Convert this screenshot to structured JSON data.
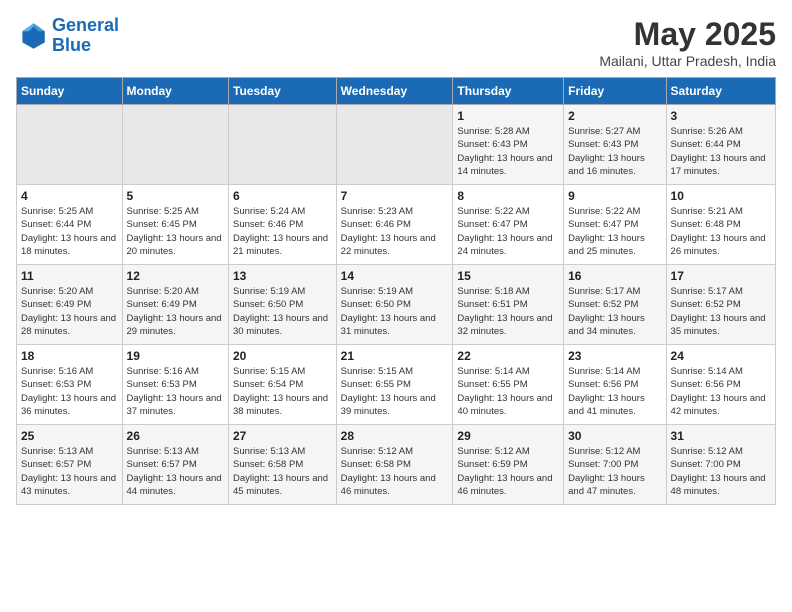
{
  "logo": {
    "line1": "General",
    "line2": "Blue"
  },
  "title": {
    "month_year": "May 2025",
    "location": "Mailani, Uttar Pradesh, India"
  },
  "headers": [
    "Sunday",
    "Monday",
    "Tuesday",
    "Wednesday",
    "Thursday",
    "Friday",
    "Saturday"
  ],
  "weeks": [
    [
      {
        "day": "",
        "sunrise": "",
        "sunset": "",
        "daylight": ""
      },
      {
        "day": "",
        "sunrise": "",
        "sunset": "",
        "daylight": ""
      },
      {
        "day": "",
        "sunrise": "",
        "sunset": "",
        "daylight": ""
      },
      {
        "day": "",
        "sunrise": "",
        "sunset": "",
        "daylight": ""
      },
      {
        "day": "1",
        "sunrise": "Sunrise: 5:28 AM",
        "sunset": "Sunset: 6:43 PM",
        "daylight": "Daylight: 13 hours and 14 minutes."
      },
      {
        "day": "2",
        "sunrise": "Sunrise: 5:27 AM",
        "sunset": "Sunset: 6:43 PM",
        "daylight": "Daylight: 13 hours and 16 minutes."
      },
      {
        "day": "3",
        "sunrise": "Sunrise: 5:26 AM",
        "sunset": "Sunset: 6:44 PM",
        "daylight": "Daylight: 13 hours and 17 minutes."
      }
    ],
    [
      {
        "day": "4",
        "sunrise": "Sunrise: 5:25 AM",
        "sunset": "Sunset: 6:44 PM",
        "daylight": "Daylight: 13 hours and 18 minutes."
      },
      {
        "day": "5",
        "sunrise": "Sunrise: 5:25 AM",
        "sunset": "Sunset: 6:45 PM",
        "daylight": "Daylight: 13 hours and 20 minutes."
      },
      {
        "day": "6",
        "sunrise": "Sunrise: 5:24 AM",
        "sunset": "Sunset: 6:46 PM",
        "daylight": "Daylight: 13 hours and 21 minutes."
      },
      {
        "day": "7",
        "sunrise": "Sunrise: 5:23 AM",
        "sunset": "Sunset: 6:46 PM",
        "daylight": "Daylight: 13 hours and 22 minutes."
      },
      {
        "day": "8",
        "sunrise": "Sunrise: 5:22 AM",
        "sunset": "Sunset: 6:47 PM",
        "daylight": "Daylight: 13 hours and 24 minutes."
      },
      {
        "day": "9",
        "sunrise": "Sunrise: 5:22 AM",
        "sunset": "Sunset: 6:47 PM",
        "daylight": "Daylight: 13 hours and 25 minutes."
      },
      {
        "day": "10",
        "sunrise": "Sunrise: 5:21 AM",
        "sunset": "Sunset: 6:48 PM",
        "daylight": "Daylight: 13 hours and 26 minutes."
      }
    ],
    [
      {
        "day": "11",
        "sunrise": "Sunrise: 5:20 AM",
        "sunset": "Sunset: 6:49 PM",
        "daylight": "Daylight: 13 hours and 28 minutes."
      },
      {
        "day": "12",
        "sunrise": "Sunrise: 5:20 AM",
        "sunset": "Sunset: 6:49 PM",
        "daylight": "Daylight: 13 hours and 29 minutes."
      },
      {
        "day": "13",
        "sunrise": "Sunrise: 5:19 AM",
        "sunset": "Sunset: 6:50 PM",
        "daylight": "Daylight: 13 hours and 30 minutes."
      },
      {
        "day": "14",
        "sunrise": "Sunrise: 5:19 AM",
        "sunset": "Sunset: 6:50 PM",
        "daylight": "Daylight: 13 hours and 31 minutes."
      },
      {
        "day": "15",
        "sunrise": "Sunrise: 5:18 AM",
        "sunset": "Sunset: 6:51 PM",
        "daylight": "Daylight: 13 hours and 32 minutes."
      },
      {
        "day": "16",
        "sunrise": "Sunrise: 5:17 AM",
        "sunset": "Sunset: 6:52 PM",
        "daylight": "Daylight: 13 hours and 34 minutes."
      },
      {
        "day": "17",
        "sunrise": "Sunrise: 5:17 AM",
        "sunset": "Sunset: 6:52 PM",
        "daylight": "Daylight: 13 hours and 35 minutes."
      }
    ],
    [
      {
        "day": "18",
        "sunrise": "Sunrise: 5:16 AM",
        "sunset": "Sunset: 6:53 PM",
        "daylight": "Daylight: 13 hours and 36 minutes."
      },
      {
        "day": "19",
        "sunrise": "Sunrise: 5:16 AM",
        "sunset": "Sunset: 6:53 PM",
        "daylight": "Daylight: 13 hours and 37 minutes."
      },
      {
        "day": "20",
        "sunrise": "Sunrise: 5:15 AM",
        "sunset": "Sunset: 6:54 PM",
        "daylight": "Daylight: 13 hours and 38 minutes."
      },
      {
        "day": "21",
        "sunrise": "Sunrise: 5:15 AM",
        "sunset": "Sunset: 6:55 PM",
        "daylight": "Daylight: 13 hours and 39 minutes."
      },
      {
        "day": "22",
        "sunrise": "Sunrise: 5:14 AM",
        "sunset": "Sunset: 6:55 PM",
        "daylight": "Daylight: 13 hours and 40 minutes."
      },
      {
        "day": "23",
        "sunrise": "Sunrise: 5:14 AM",
        "sunset": "Sunset: 6:56 PM",
        "daylight": "Daylight: 13 hours and 41 minutes."
      },
      {
        "day": "24",
        "sunrise": "Sunrise: 5:14 AM",
        "sunset": "Sunset: 6:56 PM",
        "daylight": "Daylight: 13 hours and 42 minutes."
      }
    ],
    [
      {
        "day": "25",
        "sunrise": "Sunrise: 5:13 AM",
        "sunset": "Sunset: 6:57 PM",
        "daylight": "Daylight: 13 hours and 43 minutes."
      },
      {
        "day": "26",
        "sunrise": "Sunrise: 5:13 AM",
        "sunset": "Sunset: 6:57 PM",
        "daylight": "Daylight: 13 hours and 44 minutes."
      },
      {
        "day": "27",
        "sunrise": "Sunrise: 5:13 AM",
        "sunset": "Sunset: 6:58 PM",
        "daylight": "Daylight: 13 hours and 45 minutes."
      },
      {
        "day": "28",
        "sunrise": "Sunrise: 5:12 AM",
        "sunset": "Sunset: 6:58 PM",
        "daylight": "Daylight: 13 hours and 46 minutes."
      },
      {
        "day": "29",
        "sunrise": "Sunrise: 5:12 AM",
        "sunset": "Sunset: 6:59 PM",
        "daylight": "Daylight: 13 hours and 46 minutes."
      },
      {
        "day": "30",
        "sunrise": "Sunrise: 5:12 AM",
        "sunset": "Sunset: 7:00 PM",
        "daylight": "Daylight: 13 hours and 47 minutes."
      },
      {
        "day": "31",
        "sunrise": "Sunrise: 5:12 AM",
        "sunset": "Sunset: 7:00 PM",
        "daylight": "Daylight: 13 hours and 48 minutes."
      }
    ]
  ]
}
